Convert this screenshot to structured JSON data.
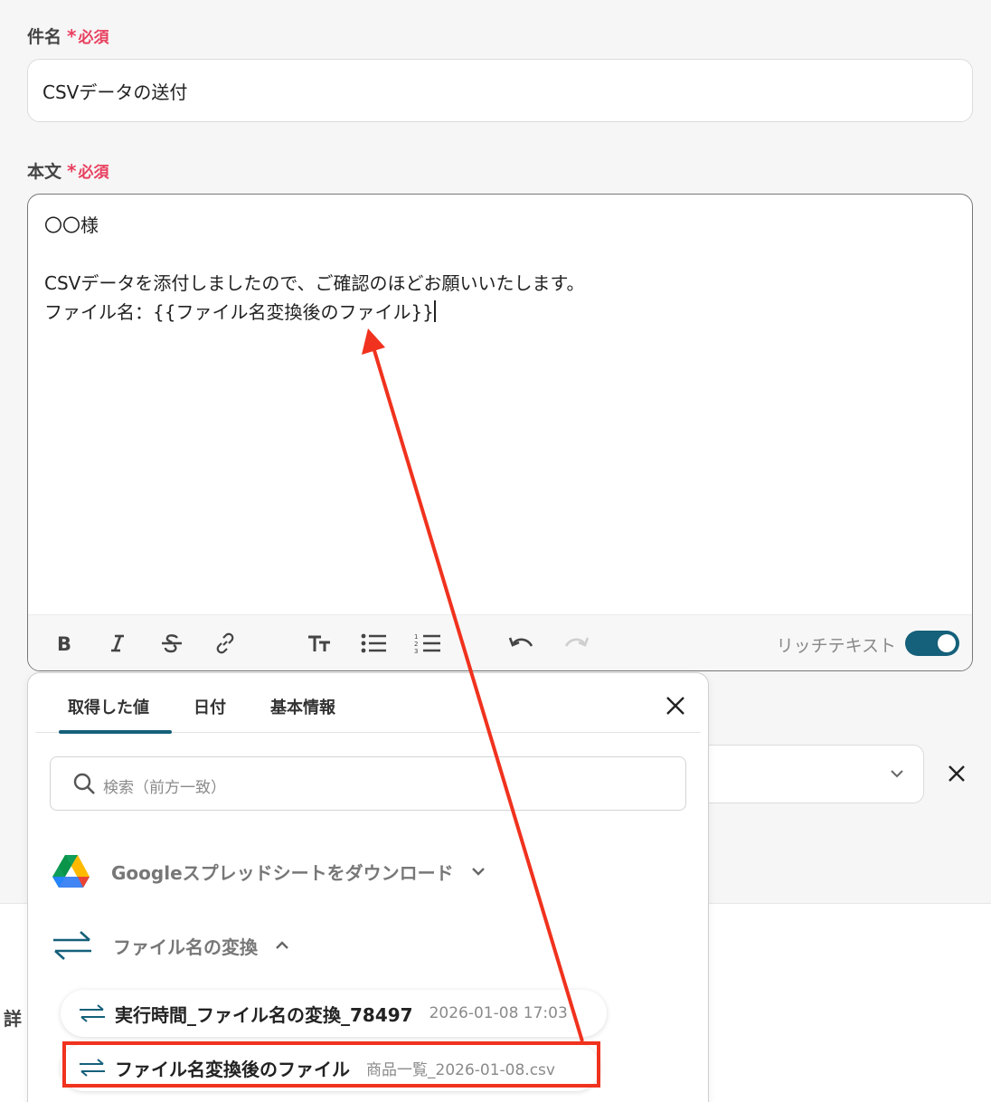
{
  "subject": {
    "label": "件名",
    "star": "*",
    "required": "必須",
    "value": "CSVデータの送付"
  },
  "body": {
    "label": "本文",
    "star": "*",
    "required": "必須",
    "lines": [
      "〇〇様",
      "",
      "CSVデータを添付しましたので、ご確認のほどお願いいたします。",
      "ファイル名：{{ファイル名変換後のファイル}}"
    ],
    "rich_text_label": "リッチテキスト",
    "rich_text_on": true
  },
  "popup": {
    "tabs": [
      "取得した値",
      "日付",
      "基本情報"
    ],
    "active_tab": 0,
    "search_placeholder": "検索（前方一致）",
    "groups": [
      {
        "title": "Googleスプレッドシートをダウンロード",
        "expanded": false,
        "icon": "google-drive-icon"
      },
      {
        "title": "ファイル名の変換",
        "expanded": true,
        "icon": "transfer-arrows-icon"
      }
    ],
    "items": [
      {
        "title": "実行時間_ファイル名の変換_78497",
        "value": "2026-01-08 17:03"
      },
      {
        "title": "ファイル名変換後のファイル",
        "value": "商品一覧_2026-01-08.csv"
      }
    ]
  },
  "background": {
    "detail_char": "詳"
  },
  "colors": {
    "accent": "#15607a",
    "required": "#e8405f",
    "annotation": "#f0321e"
  }
}
